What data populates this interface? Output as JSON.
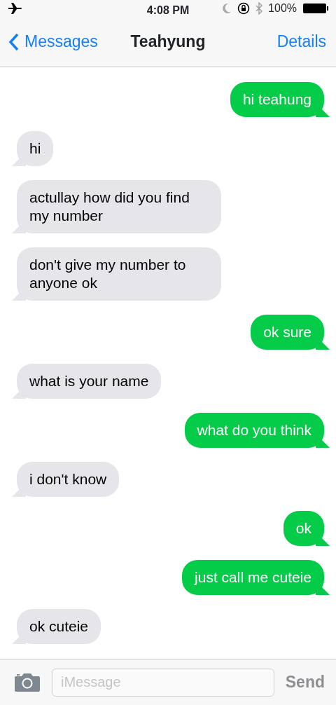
{
  "status_bar": {
    "time": "4:08 PM",
    "battery": "100%"
  },
  "nav": {
    "back": "Messages",
    "title": "Teahyung",
    "action": "Details"
  },
  "messages": [
    {
      "kind": "sent",
      "text": "hi teahung"
    },
    {
      "kind": "received",
      "text": "hi"
    },
    {
      "kind": "received",
      "text": "actullay how did you find my number"
    },
    {
      "kind": "received",
      "text": "don't give my number to anyone ok"
    },
    {
      "kind": "sent",
      "text": "ok sure"
    },
    {
      "kind": "received",
      "text": "what is your name"
    },
    {
      "kind": "sent",
      "text": "what do you think"
    },
    {
      "kind": "received",
      "text": "i don't know"
    },
    {
      "kind": "sent",
      "text": "ok"
    },
    {
      "kind": "sent",
      "text": "just call me cuteie"
    },
    {
      "kind": "received",
      "text": "ok cuteie"
    }
  ],
  "composer": {
    "placeholder": "iMessage",
    "send": "Send"
  }
}
